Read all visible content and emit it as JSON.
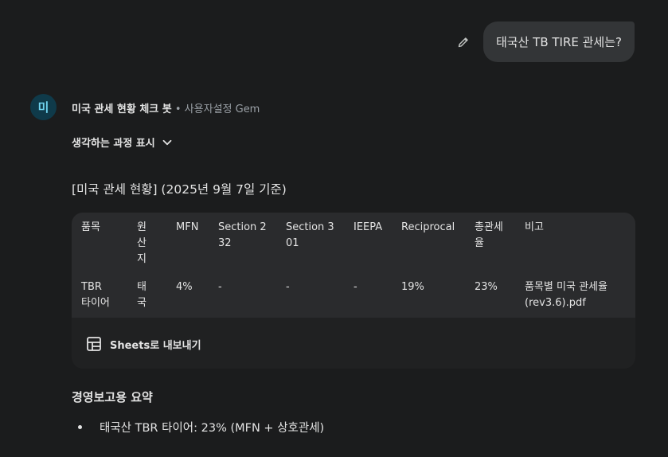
{
  "user": {
    "message": "태국산 TB TIRE 관세는?"
  },
  "gem": {
    "avatar_letter": "미",
    "name": "미국 관세 현황 체크 봇",
    "meta": " • 사용자설정 Gem"
  },
  "thinking": {
    "label": "생각하는 과정 표시"
  },
  "response": {
    "heading": "[미국 관세 현황] (2025년 9월 7일 기준)"
  },
  "table": {
    "headers": [
      "품목",
      "원산지",
      "MFN",
      "Section 232",
      "Section 301",
      "IEEPA",
      "Reciprocal",
      "총관세율",
      "비고"
    ],
    "rows": [
      [
        "TBR 타이어",
        "태국",
        "4%",
        "-",
        "-",
        "-",
        "19%",
        "23%",
        "품목별 미국 관세율 (rev3.6).pdf"
      ]
    ],
    "export_label": "Sheets로 내보내기"
  },
  "summary": {
    "title": "경영보고용 요약",
    "bullets": [
      "태국산 TBR 타이어: 23% (MFN + 상호관세)"
    ]
  },
  "colors": {
    "background": "#1b1c1d",
    "bubble": "#333537",
    "table_bg": "#2a2b2d",
    "avatar_bg": "#0f3a4a",
    "avatar_fg": "#6fd3ef"
  }
}
